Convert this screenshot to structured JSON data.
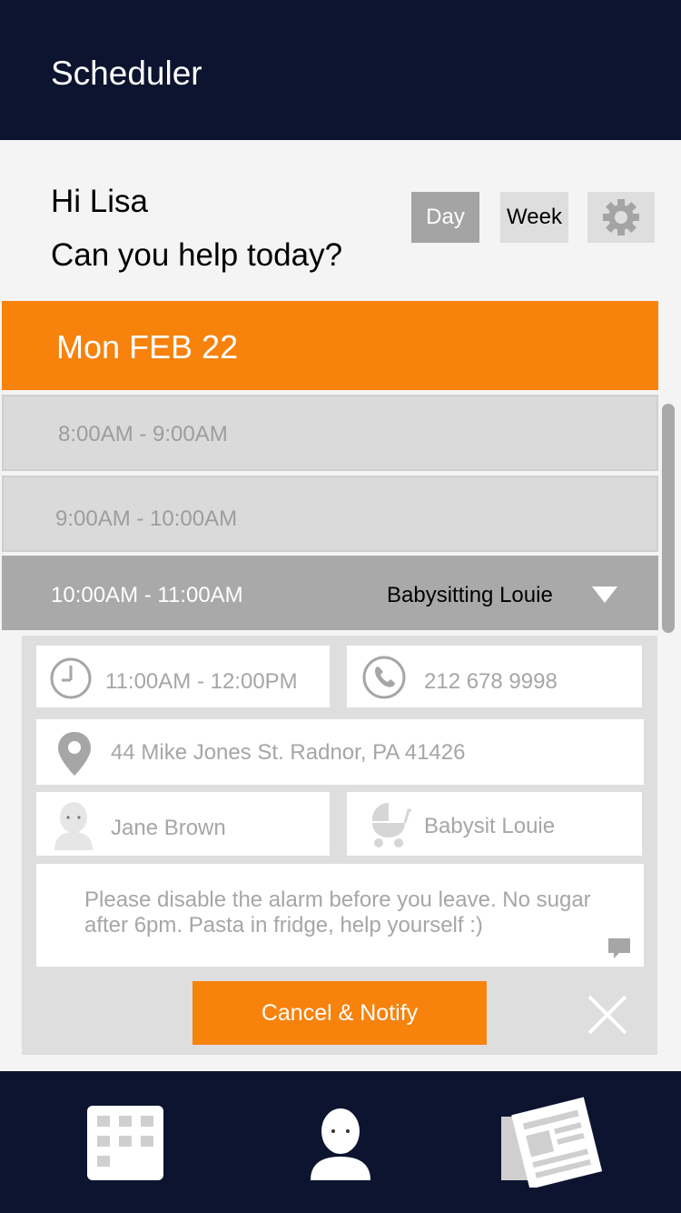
{
  "header": {
    "title": "Scheduler"
  },
  "greeting": {
    "line1": "Hi Lisa",
    "line2": "Can you help today?"
  },
  "view_toggle": {
    "day_label": "Day",
    "week_label": "Week",
    "active": "Day",
    "settings_icon": "gear-icon"
  },
  "date_header": {
    "label": "Mon FEB 22",
    "color": "#f7820c"
  },
  "slots": [
    {
      "time": "8:00AM - 9:00AM",
      "event": ""
    },
    {
      "time": "9:00AM - 10:00AM",
      "event": ""
    },
    {
      "time": "10:00AM - 11:00AM",
      "event": "Babysitting Louie",
      "expanded": true
    }
  ],
  "details": {
    "time": "11:00AM - 12:00PM",
    "phone": "212 678 9998",
    "address": "44 Mike Jones St. Radnor, PA 41426",
    "person": "Jane Brown",
    "task": "Babysit Louie",
    "note": "Please disable the alarm before you leave. No sugar after 6pm. Pasta in fridge, help yourself :)",
    "cancel_label": "Cancel & Notify"
  },
  "bottom_nav": [
    {
      "icon": "calendar-grid-icon"
    },
    {
      "icon": "profile-icon"
    },
    {
      "icon": "newspaper-icon"
    }
  ],
  "colors": {
    "navy": "#0d1430",
    "accent": "#f7820c",
    "slot_gray": "#dadada",
    "active_slot": "#a9a9a9"
  }
}
